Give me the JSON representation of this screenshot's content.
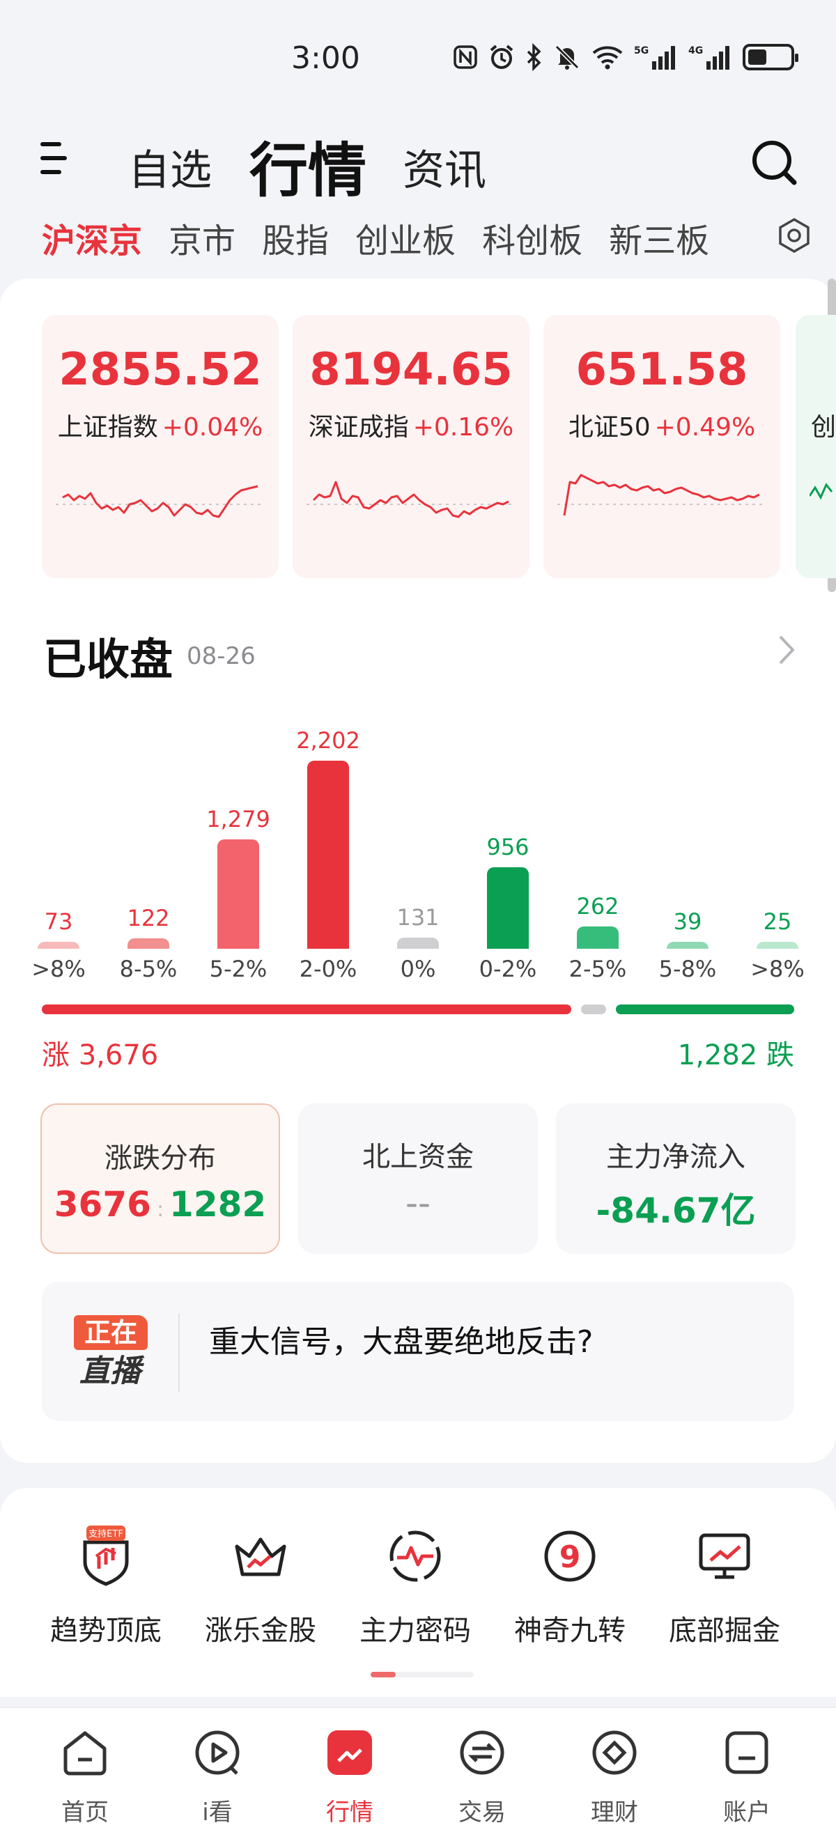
{
  "status_bar": {
    "time": "3:00",
    "icons": [
      "nfc-icon",
      "alarm-icon",
      "bluetooth-icon",
      "mute-icon",
      "wifi-icon",
      "5g-signal-icon",
      "4g-signal-icon",
      "battery-icon"
    ],
    "network_5g": "5G",
    "network_4g": "4G"
  },
  "header": {
    "tabs": [
      {
        "label": "自选",
        "active": false
      },
      {
        "label": "行情",
        "active": true
      },
      {
        "label": "资讯",
        "active": false
      }
    ]
  },
  "sub_tabs": [
    {
      "label": "沪深京",
      "active": true
    },
    {
      "label": "京市",
      "active": false
    },
    {
      "label": "股指",
      "active": false
    },
    {
      "label": "创业板",
      "active": false
    },
    {
      "label": "科创板",
      "active": false
    },
    {
      "label": "新三板",
      "active": false
    }
  ],
  "indices": [
    {
      "value": "2855.52",
      "name": "上证指数",
      "change": "+0.04%",
      "spark": [
        62,
        58,
        66,
        60,
        64,
        56,
        70,
        78,
        74,
        80,
        76,
        84,
        72,
        70,
        66,
        74,
        82,
        78,
        70,
        76,
        88,
        80,
        72,
        76,
        84,
        86,
        80,
        88,
        90,
        78,
        66,
        58,
        52,
        50,
        48,
        46
      ]
    },
    {
      "value": "8194.65",
      "name": "深证成指",
      "change": "+0.16%",
      "spark": [
        66,
        58,
        62,
        60,
        40,
        64,
        70,
        60,
        62,
        76,
        78,
        72,
        66,
        70,
        62,
        60,
        70,
        64,
        58,
        66,
        72,
        76,
        84,
        80,
        78,
        88,
        90,
        82,
        86,
        80,
        76,
        78,
        74,
        70,
        72,
        68
      ]
    },
    {
      "value": "651.58",
      "name": "北证50",
      "change": "+0.49%",
      "spark": [
        88,
        40,
        42,
        30,
        34,
        38,
        42,
        40,
        46,
        44,
        48,
        44,
        50,
        52,
        48,
        46,
        52,
        50,
        56,
        54,
        50,
        48,
        52,
        56,
        58,
        62,
        60,
        64,
        66,
        64,
        62,
        66,
        64,
        60,
        62,
        58
      ]
    }
  ],
  "peek_index": {
    "name": "创"
  },
  "market_status": {
    "title": "已收盘",
    "date": "08-26"
  },
  "distribution": {
    "categories": [
      ">8%",
      "8-5%",
      "5-2%",
      "2-0%",
      "0%",
      "0-2%",
      "2-5%",
      "5-8%",
      ">8%"
    ],
    "labels": [
      "73",
      "122",
      "1,279",
      "2,202",
      "131",
      "956",
      "262",
      "39",
      "25"
    ],
    "values": [
      73,
      122,
      1279,
      2202,
      131,
      956,
      262,
      39,
      25
    ],
    "colors": [
      "#f7b9b9",
      "#f28f8f",
      "#f2636b",
      "#e8333c",
      "#cfcfd2",
      "#0a9f52",
      "#37bd7b",
      "#8fd9b2",
      "#b9e8cf"
    ],
    "label_colors": [
      "#e8333c",
      "#e8333c",
      "#e8333c",
      "#e8333c",
      "#9a9a9e",
      "#0a9f52",
      "#0a9f52",
      "#0a9f52",
      "#0a9f52"
    ]
  },
  "rise_fall": {
    "rise_label": "涨 3,676",
    "fall_label": "1,282 跌",
    "rise_count": 3676,
    "flat_count": 131,
    "fall_count": 1282
  },
  "stats": [
    {
      "title": "涨跌分布",
      "value_rise": "3676",
      "value_fall": "1282",
      "selected": true
    },
    {
      "title": "北上资金",
      "value": "--",
      "selected": false
    },
    {
      "title": "主力净流入",
      "value": "-84.67亿",
      "selected": false
    }
  ],
  "live": {
    "badge_top": "正在",
    "badge_bottom": "直播",
    "text": "重大信号，大盘要绝地反击?"
  },
  "tools": [
    {
      "label": "趋势顶底",
      "icon": "trend-shield-icon",
      "badge": "支持ETF"
    },
    {
      "label": "涨乐金股",
      "icon": "crown-icon"
    },
    {
      "label": "主力密码",
      "icon": "pulse-circle-icon"
    },
    {
      "label": "神奇九转",
      "icon": "nine-circle-icon"
    },
    {
      "label": "底部掘金",
      "icon": "monitor-chart-icon"
    }
  ],
  "bottom_nav": [
    {
      "label": "首页",
      "icon": "home-icon",
      "active": false
    },
    {
      "label": "i看",
      "icon": "play-icon",
      "active": false
    },
    {
      "label": "行情",
      "icon": "market-icon",
      "active": true
    },
    {
      "label": "交易",
      "icon": "exchange-icon",
      "active": false
    },
    {
      "label": "理财",
      "icon": "diamond-icon",
      "active": false
    },
    {
      "label": "账户",
      "icon": "account-icon",
      "active": false
    }
  ]
}
